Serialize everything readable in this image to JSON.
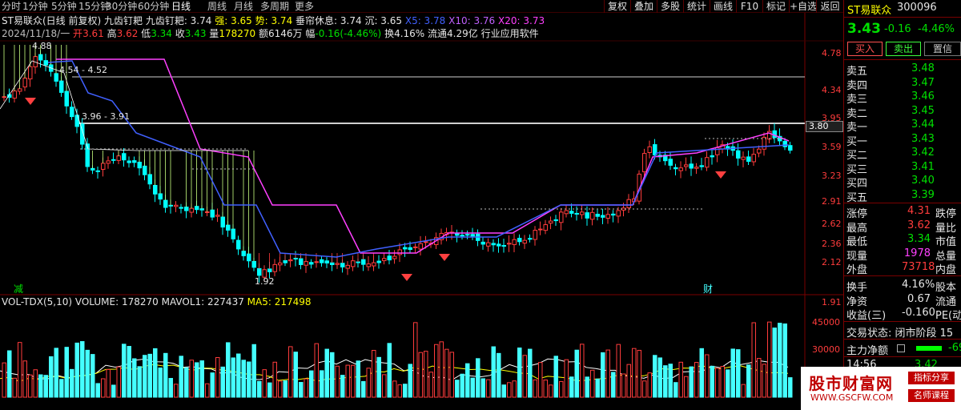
{
  "toolbar": {
    "periods": [
      "分时",
      "1分钟",
      "5分钟",
      "15分钟",
      "30分钟",
      "60分钟",
      "日线",
      "周线",
      "月线",
      "多周期",
      "更多"
    ],
    "active_period": "日线",
    "buttons": [
      "复权",
      "叠加",
      "多股",
      "统计",
      "画线",
      "F10",
      "标记",
      "+自选",
      "返回"
    ]
  },
  "chart_header": {
    "title": "ST易联众(日线 前复权)",
    "indicator": "九齿钉耙",
    "ind_line": "九齿钉耙: 3.74",
    "strong": "强: 3.65",
    "shi": "势: 3.74",
    "status": "垂帘休息: 3.74",
    "chen": "沉: 3.65",
    "x5": "X5: 3.78",
    "x10": "X10: 3.76",
    "x20": "X20: 3.73",
    "date": "2024/11/18/一",
    "open_label": "开",
    "open": "3.61",
    "high_label": "高",
    "high": "3.62",
    "low_label": "低",
    "low": "3.34",
    "close_label": "收",
    "close": "3.43",
    "vol_label": "量",
    "vol": "178270",
    "amt_label": "额",
    "amt": "6146万",
    "chg_label": "幅",
    "chg": "-0.16(-4.46%)",
    "turnover": "换4.16%",
    "float_cap": "流通4.29亿",
    "industry": "行业应用软件"
  },
  "price_axis": {
    "labels": [
      "4.78",
      "4.34",
      "3.95",
      "3.59",
      "3.23",
      "2.91",
      "2.62",
      "2.36",
      "2.12",
      "1.91"
    ],
    "current_tag": "3.80"
  },
  "annotations": {
    "hi_a": "4.88",
    "range_a": "4.54 - 4.52",
    "range_b": "3.96 - 3.91",
    "low_a": "1.92",
    "jian": "减",
    "cai": "财"
  },
  "volume_header": {
    "name": "VOL-TDX(5,10)",
    "volume": "VOLUME: 178270",
    "mavol1": "MAVOL1: 227437",
    "ma5": "MA5: 217498"
  },
  "volume_axis": {
    "labels": [
      "45000",
      "30000"
    ]
  },
  "quote": {
    "name": "ST易联众",
    "code": "300096",
    "price": "3.43",
    "change": "-0.16",
    "pct": "-4.46%",
    "buy_btn": "买入",
    "sell_btn": "卖出",
    "other_btn": "置信",
    "asks": [
      {
        "label": "卖五",
        "price": "3.48"
      },
      {
        "label": "卖四",
        "price": "3.47"
      },
      {
        "label": "卖三",
        "price": "3.46"
      },
      {
        "label": "卖二",
        "price": "3.45"
      },
      {
        "label": "卖一",
        "price": "3.44"
      }
    ],
    "bids": [
      {
        "label": "买一",
        "price": "3.43"
      },
      {
        "label": "买二",
        "price": "3.42"
      },
      {
        "label": "买三",
        "price": "3.41"
      },
      {
        "label": "买四",
        "price": "3.40"
      },
      {
        "label": "买五",
        "price": "3.39"
      }
    ],
    "stats": [
      {
        "label": "涨停",
        "value": "4.31",
        "label2": "跌停"
      },
      {
        "label": "最高",
        "value": "3.62",
        "label2": "量比"
      },
      {
        "label": "最低",
        "value": "3.34",
        "label2": "市值"
      },
      {
        "label": "现量",
        "value": "1978",
        "label2": "总量"
      },
      {
        "label": "外盘",
        "value": "73718",
        "label2": "内盘"
      }
    ],
    "fin": [
      {
        "label": "换手",
        "value": "4.16%",
        "label2": "股本"
      },
      {
        "label": "净资",
        "value": "0.67",
        "label2": "流通"
      },
      {
        "label": "收益(三)",
        "value": "-0.160",
        "label2": "PE(动"
      }
    ],
    "trade_state": "交易状态: 闭市阶段 15",
    "main_flow": "主力净额",
    "main_flow_val": "-69",
    "time": "14:56",
    "time_price": "3.42"
  },
  "watermark": {
    "brand": "股市财富网",
    "tag1": "指标分享",
    "tag2": "名师课程",
    "url": "WWW.GSCFW.COM"
  },
  "colors": {
    "up": "#ff3c3c",
    "down": "#00ffff",
    "bg": "#000000",
    "accent": "#ff40ff"
  }
}
